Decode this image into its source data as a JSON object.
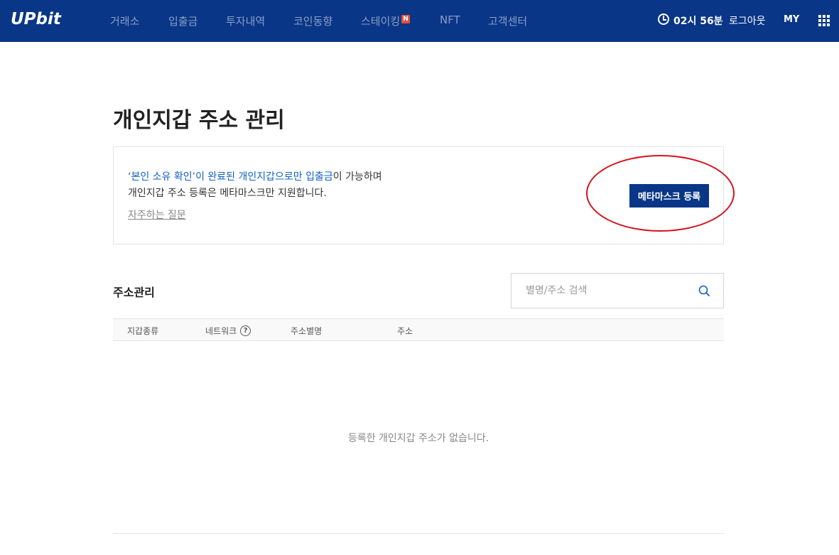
{
  "header": {
    "logo": "UPbit",
    "nav": [
      {
        "label": "거래소"
      },
      {
        "label": "입출금"
      },
      {
        "label": "투자내역"
      },
      {
        "label": "코인동향"
      },
      {
        "label": "스테이킹",
        "badge": "N"
      },
      {
        "label": "NFT"
      },
      {
        "label": "고객센터"
      }
    ],
    "time": "02시 56분",
    "logout": "로그아웃",
    "my": "MY"
  },
  "page": {
    "title": "개인지갑 주소 관리"
  },
  "notice": {
    "blue1": "‘본인 소유 확인’이 완료된 개인지갑으로만 입출금",
    "rest1": "이 가능하며",
    "line2": "개인지갑 주소 등록은 메타마스크만 지원합니다.",
    "faq": "자주하는 질문",
    "button": "메타마스크 등록"
  },
  "address": {
    "title": "주소관리",
    "search_placeholder": "별명/주소 검색",
    "columns": [
      "지갑종류",
      "네트워크",
      "주소별명",
      "주소"
    ],
    "empty": "등록한 개인지갑 주소가 없습니다."
  },
  "colors": {
    "brand": "#093687",
    "link": "#1261c4",
    "annotation": "#d4131b"
  }
}
